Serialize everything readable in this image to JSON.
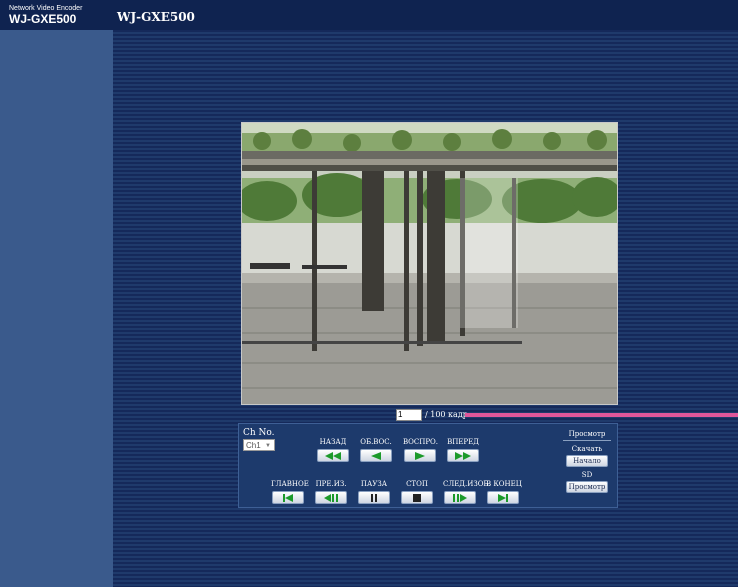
{
  "header": {
    "brand_line1": "Network Video Encoder",
    "brand_line2": "WJ-GXE500",
    "model_title": "WJ-GXE500"
  },
  "viewer": {
    "image_name": "surveillance-frame"
  },
  "frame": {
    "current_value": "1",
    "total_label": "/ 100 кадр"
  },
  "controls": {
    "ch_label": "Ch No.",
    "ch_selected": "Ch1",
    "row1": [
      {
        "label": "НАЗАД",
        "icon": "fast-rewind-icon"
      },
      {
        "label": "ОБ.ВОС.",
        "icon": "reverse-play-icon"
      },
      {
        "label": "ВОСПРО.",
        "icon": "play-icon"
      },
      {
        "label": "ВПЕРЕД",
        "icon": "fast-forward-icon"
      }
    ],
    "row2": [
      {
        "label": "ГЛАВНОЕ",
        "icon": "skip-start-icon"
      },
      {
        "label": "ПРЕ.ИЗ.",
        "icon": "previous-frame-icon"
      },
      {
        "label": "ПАУЗА",
        "icon": "pause-icon"
      },
      {
        "label": "СТОП",
        "icon": "stop-icon"
      },
      {
        "label": "СЛЕД.ИЗОБ.",
        "icon": "next-frame-icon"
      },
      {
        "label": "В КОНЕЦ",
        "icon": "skip-end-icon"
      }
    ]
  },
  "right_panel": {
    "view_title": "Просмотр",
    "download_label": "Скачать",
    "start_button": "Начало",
    "sd_label": "SD",
    "view_button": "Просмотр"
  },
  "colors": {
    "topbar": "#0f2350",
    "sidebar": "#3a5a8c",
    "accent_progress": "#e0569a",
    "icon_green": "#1c9a2a"
  }
}
